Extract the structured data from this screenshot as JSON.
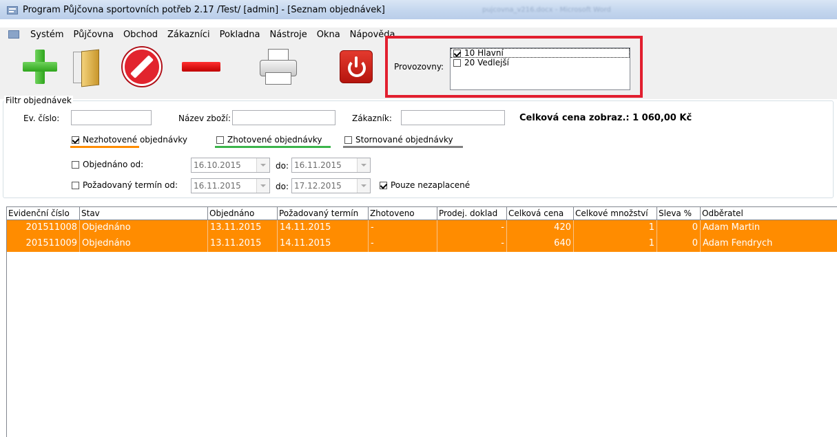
{
  "window": {
    "title": "Program Půjčovna sportovních potřeb 2.17 /Test/ [admin] - [Seznam objednávek]",
    "background_title": "pujcovna_v216.docx - Microsoft Word"
  },
  "menu": {
    "items": [
      "Systém",
      "Půjčovna",
      "Obchod",
      "Zákazníci",
      "Pokladna",
      "Nástroje",
      "Okna",
      "Nápověda"
    ]
  },
  "toolbar": {
    "buttons": [
      "add-icon",
      "document-icon",
      "cancel-icon",
      "delete-icon",
      "printer-icon",
      "power-icon"
    ]
  },
  "provozovny": {
    "label": "Provozovny:",
    "items": [
      {
        "label": "10 Hlavní",
        "checked": true
      },
      {
        "label": "20 Vedlejší",
        "checked": false
      }
    ]
  },
  "filter": {
    "legend": "Filtr objednávek",
    "ev_cislo_label": "Ev. číslo:",
    "ev_cislo_value": "",
    "nazev_zbozi_label": "Název zboží:",
    "nazev_zbozi_value": "",
    "zakaznik_label": "Zákazník:",
    "zakaznik_value": "",
    "total_text": "Celková cena zobraz.: 1 060,00 Kč",
    "nezhotovene_label": "Nezhotovené objednávky",
    "nezhotovene_checked": true,
    "zhotovene_label": "Zhotovené objednávky",
    "zhotovene_checked": false,
    "stornovane_label": "Stornované objednávky",
    "stornovane_checked": false,
    "objednano_od_label": "Objednáno od:",
    "objednano_od_checked": false,
    "objednano_from": "16.10.2015",
    "do_label": "do:",
    "objednano_to": "16.11.2015",
    "termin_od_label": "Požadovaný termín od:",
    "termin_od_checked": false,
    "termin_from": "16.11.2015",
    "termin_to": "17.12.2015",
    "pouze_label": "Pouze nezaplacené",
    "pouze_checked": true,
    "colors": {
      "nezhotovene": "#ff8c00",
      "zhotovene": "#3bb44a",
      "stornovane": "#808080"
    }
  },
  "grid": {
    "columns": [
      "Evidenční číslo",
      "Stav",
      "Objednáno",
      "Požadovaný termín",
      "Zhotoveno",
      "Prodej. doklad",
      "Celková cena",
      "Celkové množství",
      "Sleva %",
      "Odběratel"
    ],
    "rows": [
      [
        "201511008",
        "Objednáno",
        "13.11.2015",
        "14.11.2015",
        "-",
        "-",
        "420",
        "1",
        "0",
        "Adam Martin"
      ],
      [
        "201511009",
        "Objednáno",
        "13.11.2015",
        "14.11.2015",
        "-",
        "-",
        "640",
        "1",
        "0",
        "Adam Fendrych"
      ]
    ],
    "row_color": "#ff8c00"
  }
}
